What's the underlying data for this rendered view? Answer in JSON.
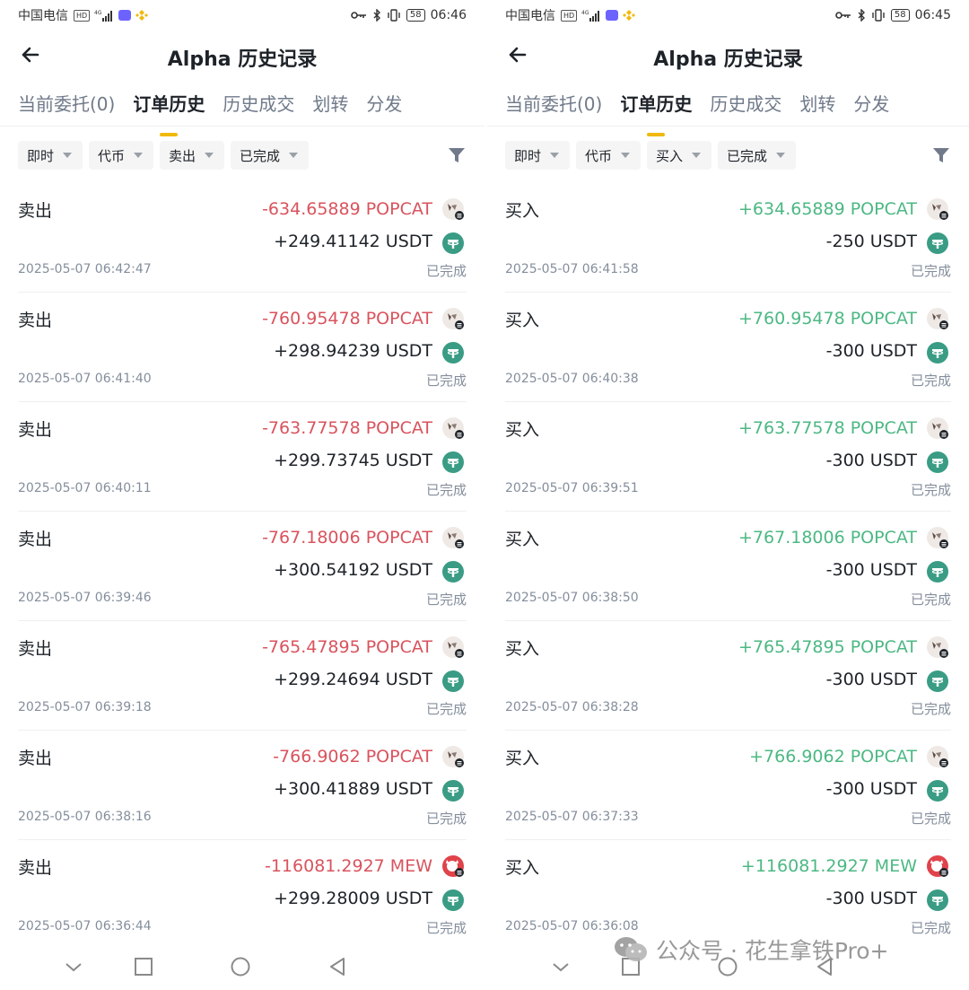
{
  "status_left": {
    "carrier": "中国电信",
    "hd": "HD",
    "net": "4G"
  },
  "panels": [
    {
      "time": "06:46",
      "battery": "58",
      "title": "Alpha 历史记录",
      "tabs": [
        "当前委托(0)",
        "订单历史",
        "历史成交",
        "划转",
        "分发"
      ],
      "filters": [
        "即时",
        "代币",
        "卖出",
        "已完成"
      ],
      "rows": [
        {
          "side": "卖出",
          "amt1": "-634.65889 POPCAT",
          "amt2": "+249.41142 USDT",
          "time": "2025-05-07 06:42:47",
          "status": "已完成",
          "token": "popcat"
        },
        {
          "side": "卖出",
          "amt1": "-760.95478 POPCAT",
          "amt2": "+298.94239 USDT",
          "time": "2025-05-07 06:41:40",
          "status": "已完成",
          "token": "popcat"
        },
        {
          "side": "卖出",
          "amt1": "-763.77578 POPCAT",
          "amt2": "+299.73745 USDT",
          "time": "2025-05-07 06:40:11",
          "status": "已完成",
          "token": "popcat"
        },
        {
          "side": "卖出",
          "amt1": "-767.18006 POPCAT",
          "amt2": "+300.54192 USDT",
          "time": "2025-05-07 06:39:46",
          "status": "已完成",
          "token": "popcat"
        },
        {
          "side": "卖出",
          "amt1": "-765.47895 POPCAT",
          "amt2": "+299.24694 USDT",
          "time": "2025-05-07 06:39:18",
          "status": "已完成",
          "token": "popcat"
        },
        {
          "side": "卖出",
          "amt1": "-766.9062 POPCAT",
          "amt2": "+300.41889 USDT",
          "time": "2025-05-07 06:38:16",
          "status": "已完成",
          "token": "popcat"
        },
        {
          "side": "卖出",
          "amt1": "-116081.2927 MEW",
          "amt2": "+299.28009 USDT",
          "time": "2025-05-07 06:36:44",
          "status": "已完成",
          "token": "mew"
        }
      ]
    },
    {
      "time": "06:45",
      "battery": "58",
      "title": "Alpha 历史记录",
      "tabs": [
        "当前委托(0)",
        "订单历史",
        "历史成交",
        "划转",
        "分发"
      ],
      "filters": [
        "即时",
        "代币",
        "买入",
        "已完成"
      ],
      "rows": [
        {
          "side": "买入",
          "amt1": "+634.65889 POPCAT",
          "amt2": "-250 USDT",
          "time": "2025-05-07 06:41:58",
          "status": "已完成",
          "token": "popcat"
        },
        {
          "side": "买入",
          "amt1": "+760.95478 POPCAT",
          "amt2": "-300 USDT",
          "time": "2025-05-07 06:40:38",
          "status": "已完成",
          "token": "popcat"
        },
        {
          "side": "买入",
          "amt1": "+763.77578 POPCAT",
          "amt2": "-300 USDT",
          "time": "2025-05-07 06:39:51",
          "status": "已完成",
          "token": "popcat"
        },
        {
          "side": "买入",
          "amt1": "+767.18006 POPCAT",
          "amt2": "-300 USDT",
          "time": "2025-05-07 06:38:50",
          "status": "已完成",
          "token": "popcat"
        },
        {
          "side": "买入",
          "amt1": "+765.47895 POPCAT",
          "amt2": "-300 USDT",
          "time": "2025-05-07 06:38:28",
          "status": "已完成",
          "token": "popcat"
        },
        {
          "side": "买入",
          "amt1": "+766.9062 POPCAT",
          "amt2": "-300 USDT",
          "time": "2025-05-07 06:37:33",
          "status": "已完成",
          "token": "popcat"
        },
        {
          "side": "买入",
          "amt1": "+116081.2927 MEW",
          "amt2": "-300 USDT",
          "time": "2025-05-07 06:36:08",
          "status": "已完成",
          "token": "mew"
        }
      ]
    }
  ],
  "watermark": "公众号 · 花生拿铁Pro+",
  "colors": {
    "negative": "#d9535d",
    "positive": "#4cb883",
    "accent": "#f0b90b",
    "muted": "#848e9c"
  },
  "icons": {
    "back": "arrow-left-icon",
    "filter": "funnel-icon",
    "usdt": "usdt-token-icon",
    "popcat": "popcat-token-icon",
    "mew": "mew-token-icon",
    "nav": [
      "chevron-down-icon",
      "square-icon",
      "circle-icon",
      "triangle-back-icon"
    ]
  }
}
